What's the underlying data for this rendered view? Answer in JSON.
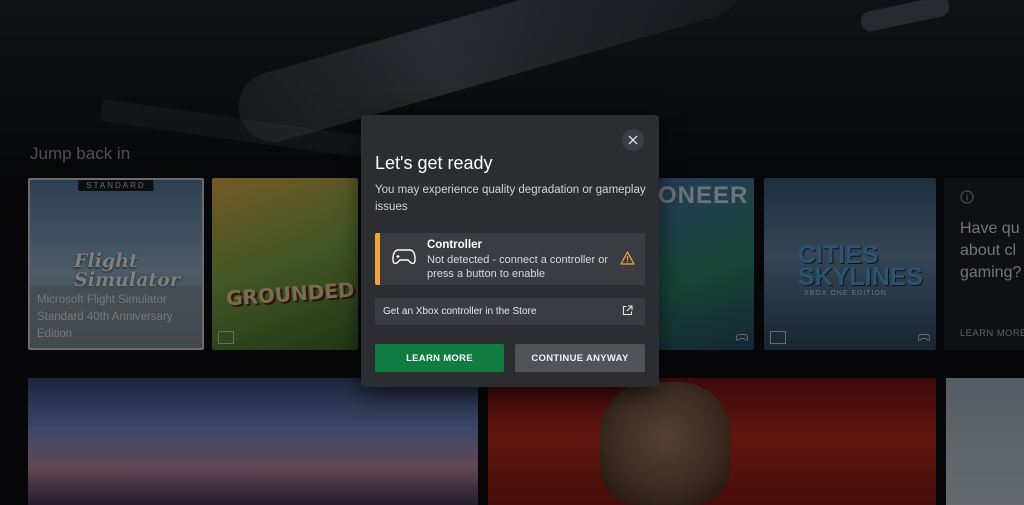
{
  "home": {
    "section_title": "Jump back in",
    "tiles": [
      {
        "badge": "STANDARD",
        "logo_line1": "Flight",
        "logo_line2": "Simulator",
        "caption": "Microsoft Flight Simulator Standard 40th Anniversary Edition"
      },
      {
        "logo": "GROUNDED"
      },
      {
        "logo_fragment": "ONEER"
      },
      {
        "logo": "CITIES",
        "logo_line2": "SKYLINES",
        "subtitle": "XBOX ONE EDITION"
      }
    ],
    "side_panel": {
      "info_icon": "info-icon",
      "heading": "Have qu\nabout cl\ngaming?",
      "link": "LEARN MORE"
    }
  },
  "dialog": {
    "title": "Let's get ready",
    "message": "You may experience quality degradation or gameplay issues",
    "controller_card": {
      "title": "Controller",
      "status": "Not detected - connect a controller or press a button to enable",
      "accent_color": "#f0a43a",
      "icon": "gamepad-icon",
      "status_icon": "warning-icon"
    },
    "store_link": {
      "label": "Get an Xbox controller in the Store",
      "icon": "external-link-icon"
    },
    "primary_button": "LEARN MORE",
    "secondary_button": "CONTINUE ANYWAY",
    "close_icon": "close-icon"
  },
  "colors": {
    "primary_green": "#107c41",
    "dialog_bg": "#2b2d31",
    "card_bg": "#3a3c41",
    "warning": "#f0a43a"
  }
}
